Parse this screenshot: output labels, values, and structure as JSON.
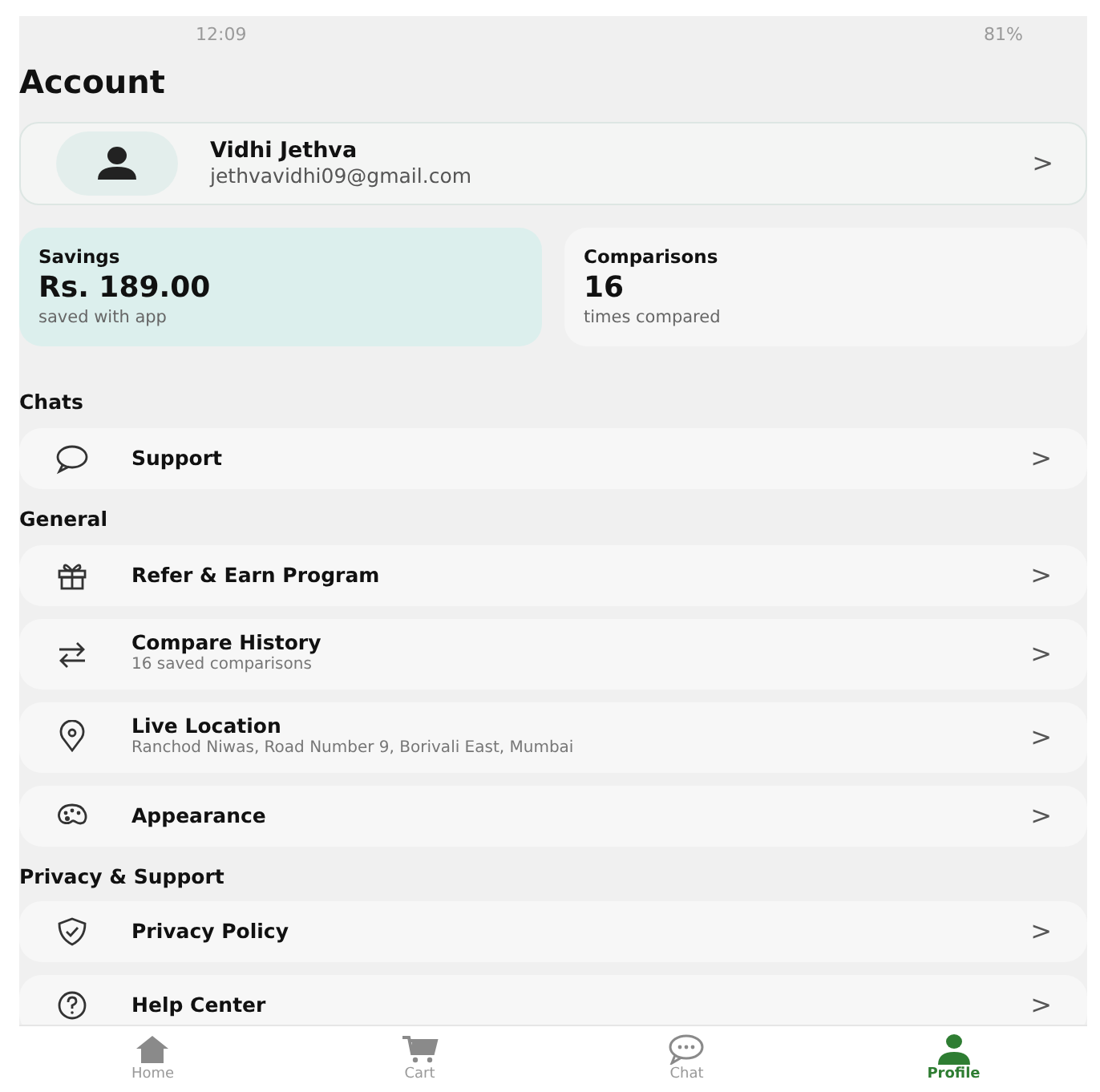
{
  "status_bar": {
    "time": "12:09",
    "battery": "81%"
  },
  "title": "Account",
  "profile": {
    "name": "Vidhi Jethva",
    "email": "jethvavidhi09@gmail.com",
    "chevron": ">"
  },
  "stats": [
    {
      "label": "Savings",
      "value": "Rs. 189.00",
      "caption": "saved with app",
      "highlighted": true
    },
    {
      "label": "Comparisons",
      "value": "16",
      "caption": "times compared",
      "highlighted": false
    }
  ],
  "sections": [
    {
      "heading": "Chats",
      "items": [
        {
          "title": "Support",
          "chevron": ">"
        }
      ]
    },
    {
      "heading": "General",
      "items": [
        {
          "title": "Refer & Earn Program",
          "chevron": ">"
        },
        {
          "title": "Compare History",
          "subtitle": "16 saved comparisons",
          "chevron": ">"
        },
        {
          "title": "Live Location",
          "subtitle": "Ranchod Niwas, Road Number 9, Borivali East, Mumbai",
          "chevron": ">"
        },
        {
          "title": "Appearance",
          "chevron": ">"
        }
      ]
    },
    {
      "heading": "Privacy & Support",
      "items": [
        {
          "title": "Privacy Policy",
          "chevron": ">"
        },
        {
          "title": "Help Center",
          "chevron": ">"
        }
      ]
    }
  ],
  "nav": [
    {
      "label": "Home",
      "selected": false
    },
    {
      "label": "Cart",
      "selected": false
    },
    {
      "label": "Chat",
      "selected": false
    },
    {
      "label": "Profile",
      "selected": true
    }
  ]
}
